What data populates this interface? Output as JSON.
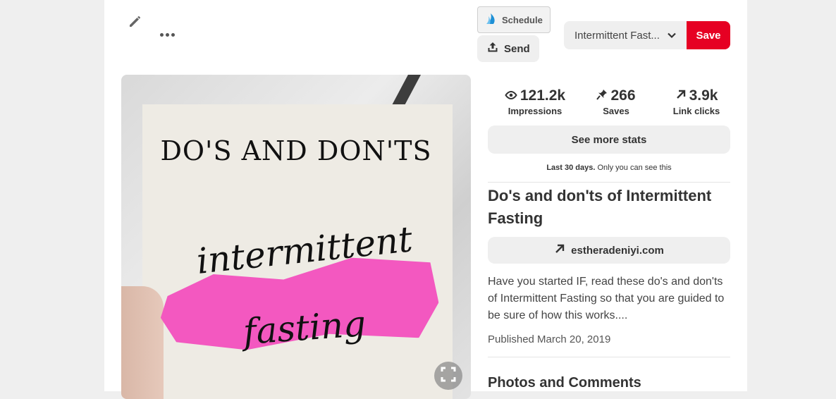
{
  "header": {
    "schedule_label": "Schedule",
    "send_label": "Send",
    "board_name": "Intermittent Fast...",
    "save_label": "Save"
  },
  "image": {
    "line1": "DO'S AND DON'TS",
    "line2": "intermittent",
    "line3": "fasting"
  },
  "stats": {
    "impressions": {
      "value": "121.2k",
      "label": "Impressions"
    },
    "saves": {
      "value": "266",
      "label": "Saves"
    },
    "link_clicks": {
      "value": "3.9k",
      "label": "Link clicks"
    },
    "see_more_label": "See more stats",
    "period_bold": "Last 30 days.",
    "period_note": "Only you can see this"
  },
  "pin": {
    "title": "Do's and don'ts of Intermittent Fasting",
    "link": "estheradeniyi.com",
    "description": "Have you started IF, read these do's and don'ts of Intermittent Fasting so that you are guided to be sure of how this works....",
    "published": "Published March 20, 2019"
  },
  "sections": {
    "photos_comments": "Photos and Comments"
  },
  "colors": {
    "save_red": "#e60023",
    "pink_highlight": "#f358c0",
    "schedule_icon_blue": "#1e90d6"
  }
}
